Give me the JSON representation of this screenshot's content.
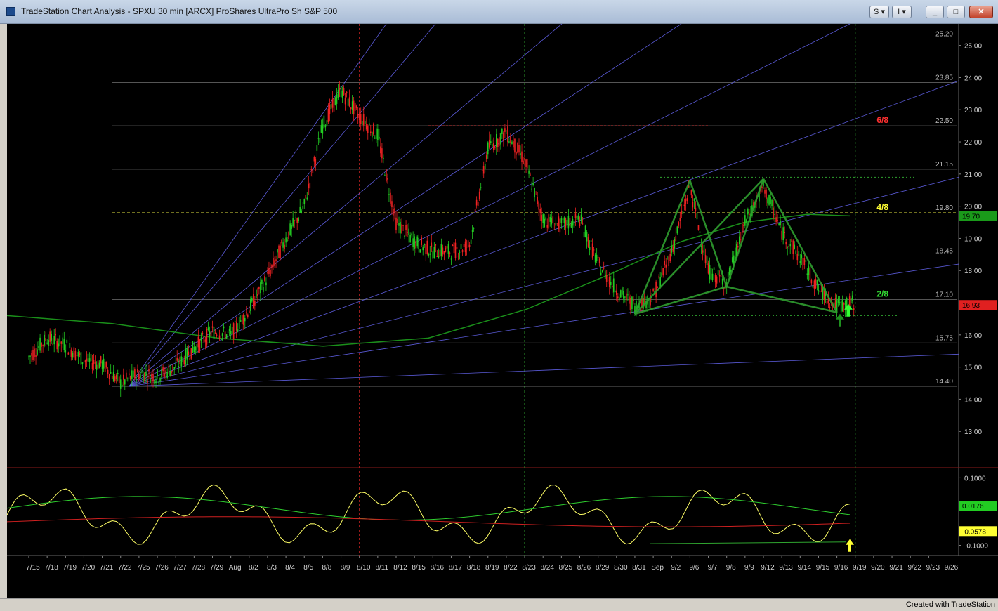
{
  "window": {
    "title": "TradeStation Chart Analysis - SPXU 30 min [ARCX] ProShares UltraPro Sh S&P 500",
    "buttons": {
      "s": "S",
      "i": "I",
      "minimize": "_",
      "maximize": "□",
      "close": "✕"
    }
  },
  "footer": {
    "created": "Created with TradeStation"
  },
  "colors": {
    "background": "#000000",
    "up": "#22cc22",
    "down": "#ee2222",
    "fan": "#6b6bff",
    "murrey": "#aaaaaa",
    "pattern": "#2f9d2f",
    "oscillator": "#ffff66"
  },
  "chart_data": [
    {
      "type": "line",
      "symbol": "SPXU 30 min [ARCX]",
      "x_tick_labels": [
        "7/15",
        "7/18",
        "7/19",
        "7/20",
        "7/21",
        "7/22",
        "7/25",
        "7/26",
        "7/27",
        "7/28",
        "7/29",
        "Aug",
        "8/2",
        "8/3",
        "8/4",
        "8/5",
        "8/8",
        "8/9",
        "8/10",
        "8/11",
        "8/12",
        "8/15",
        "8/16",
        "8/17",
        "8/18",
        "8/19",
        "8/22",
        "8/23",
        "8/24",
        "8/25",
        "8/26",
        "8/29",
        "8/30",
        "8/31",
        "Sep",
        "9/2",
        "9/6",
        "9/7",
        "9/8",
        "9/9",
        "9/12",
        "9/13",
        "9/14",
        "9/15",
        "9/16",
        "9/19",
        "9/20",
        "9/21",
        "9/22",
        "9/23",
        "9/26"
      ],
      "y_tick_labels": [
        "13.00",
        "14.00",
        "15.00",
        "16.00",
        "17.00",
        "18.00",
        "19.00",
        "20.00",
        "21.00",
        "22.00",
        "23.00",
        "24.00",
        "25.00"
      ],
      "ylim": [
        12.0,
        25.8
      ],
      "grid": false,
      "murrey_levels": [
        {
          "value": 25.2,
          "label": "25.20"
        },
        {
          "value": 23.85,
          "label": "23.85"
        },
        {
          "value": 22.5,
          "label": "22.50",
          "tag": "6/8"
        },
        {
          "value": 21.15,
          "label": "21.15"
        },
        {
          "value": 19.8,
          "label": "19.80",
          "tag": "4/8"
        },
        {
          "value": 18.45,
          "label": "18.45"
        },
        {
          "value": 17.1,
          "label": "17.10",
          "tag": "2/8"
        },
        {
          "value": 15.75,
          "label": "15.75"
        },
        {
          "value": 14.4,
          "label": "14.40"
        }
      ],
      "last_price": {
        "value": 16.93,
        "label": "16.93"
      },
      "ma_last": {
        "value": 19.7,
        "label": "19.70"
      },
      "price_path": [
        [
          "7/15",
          15.3
        ],
        [
          "7/18",
          15.9
        ],
        [
          "7/19",
          15.7
        ],
        [
          "7/20",
          15.2
        ],
        [
          "7/21",
          15.1
        ],
        [
          "7/22",
          14.5
        ],
        [
          "7/25",
          14.8
        ],
        [
          "7/26",
          14.7
        ],
        [
          "7/27",
          15.0
        ],
        [
          "7/28",
          15.6
        ],
        [
          "7/29",
          16.1
        ],
        [
          "Aug",
          16.0
        ],
        [
          "8/2",
          16.8
        ],
        [
          "8/3",
          17.8
        ],
        [
          "8/4",
          19.0
        ],
        [
          "8/5",
          20.0
        ],
        [
          "8/8",
          22.5
        ],
        [
          "8/9",
          23.6
        ],
        [
          "8/10",
          22.8
        ],
        [
          "8/11",
          22.2
        ],
        [
          "8/12",
          19.5
        ],
        [
          "8/15",
          18.9
        ],
        [
          "8/16",
          18.6
        ],
        [
          "8/17",
          18.6
        ],
        [
          "8/18",
          18.8
        ],
        [
          "8/19",
          21.8
        ],
        [
          "8/22",
          22.3
        ],
        [
          "8/23",
          21.4
        ],
        [
          "8/24",
          19.6
        ],
        [
          "8/25",
          19.4
        ],
        [
          "8/26",
          19.6
        ],
        [
          "8/29",
          18.2
        ],
        [
          "8/30",
          17.4
        ],
        [
          "8/31",
          16.9
        ],
        [
          "Sep",
          17.2
        ],
        [
          "9/2",
          18.6
        ],
        [
          "9/6",
          20.6
        ],
        [
          "9/7",
          18.0
        ],
        [
          "9/8",
          17.6
        ],
        [
          "9/9",
          19.5
        ],
        [
          "9/12",
          20.6
        ],
        [
          "9/13",
          19.2
        ],
        [
          "9/14",
          18.4
        ],
        [
          "9/15",
          17.4
        ],
        [
          "9/16",
          16.9
        ],
        [
          "9/19",
          17.0
        ]
      ]
    },
    {
      "type": "line",
      "indicator": "oscillator",
      "y_tick_labels": [
        "0.1000",
        "-0.1000"
      ],
      "ylim": [
        -0.13,
        0.13
      ],
      "value_labels": [
        {
          "value": 0.0176,
          "label": "0.0176"
        },
        {
          "value": -0.0578,
          "label": "-0.0578"
        }
      ]
    }
  ]
}
